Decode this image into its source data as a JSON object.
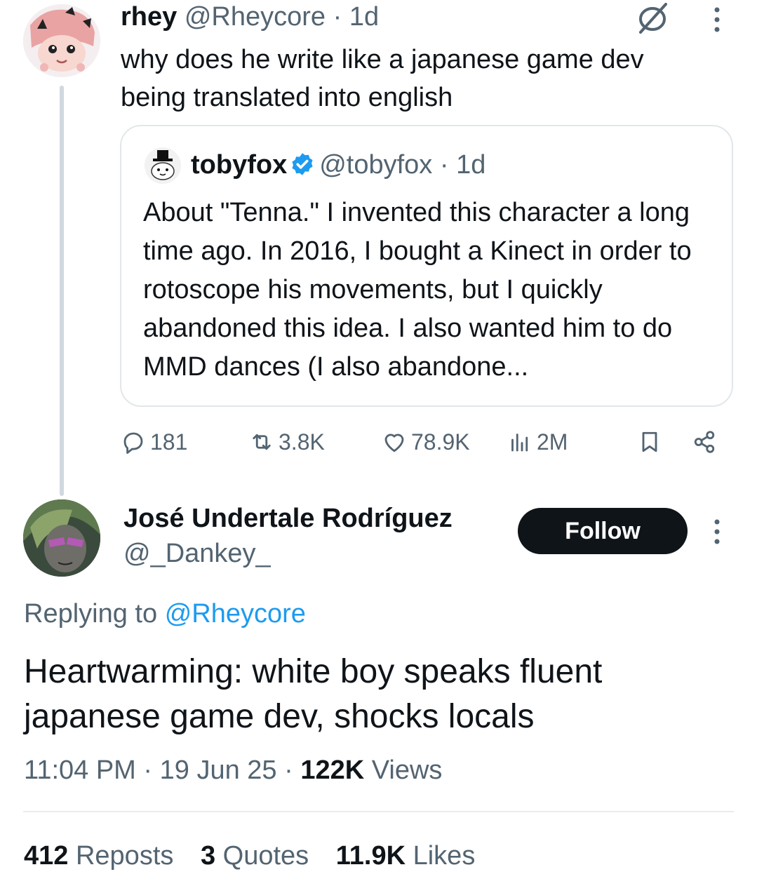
{
  "parent_tweet": {
    "display_name": "rhey",
    "handle": "@Rheycore",
    "time": "1d",
    "text": "why does he write like a japanese game dev being translated into english",
    "icons": {
      "top_right": "empty-set-icon",
      "menu": "more-vertical-icon"
    },
    "quote": {
      "display_name": "tobyfox",
      "handle": "@tobyfox",
      "time": "1d",
      "verified": true,
      "text": "About \"Tenna.\" I invented this character a long time ago. In 2016, I bought a Kinect in order to rotoscope his movements, but I quickly abandoned this idea. I also wanted him to do MMD dances (I also abandone..."
    },
    "actions": {
      "replies": "181",
      "reposts": "3.8K",
      "likes": "78.9K",
      "views": "2M"
    }
  },
  "main_tweet": {
    "display_name": "José Undertale Rodríguez",
    "handle": "@_Dankey_",
    "follow_label": "Follow",
    "replying_prefix": "Replying to",
    "replying_handle": "@Rheycore",
    "text": "Heartwarming: white boy speaks fluent japanese game dev, shocks locals",
    "time": "11:04 PM",
    "date": "19 Jun 25",
    "views_count": "122K",
    "views_label": "Views",
    "stats": {
      "reposts_count": "412",
      "reposts_label": "Reposts",
      "quotes_count": "3",
      "quotes_label": "Quotes",
      "likes_count": "11.9K",
      "likes_label": "Likes"
    }
  },
  "colors": {
    "text": "#0f1419",
    "muted": "#536471",
    "link": "#1d9bf0",
    "verified": "#1d9bf0",
    "follow_bg": "#0f1419",
    "border": "#e1e7eb"
  }
}
